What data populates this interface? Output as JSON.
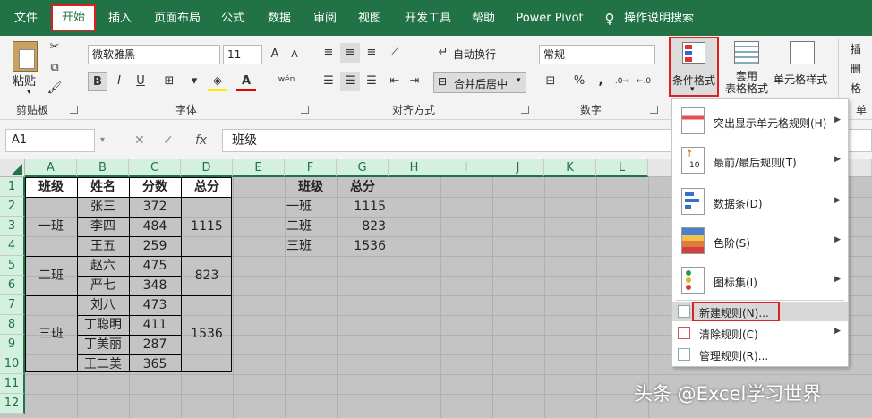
{
  "tabs": [
    "文件",
    "开始",
    "插入",
    "页面布局",
    "公式",
    "数据",
    "审阅",
    "视图",
    "开发工具",
    "帮助",
    "Power Pivot",
    "操作说明搜索"
  ],
  "ribbon": {
    "paste": "粘贴",
    "font_name": "微软雅黑",
    "font_size": "11",
    "wrap": "自动换行",
    "merge": "合并后居中",
    "number_format": "常规",
    "cond_format": "条件格式",
    "table_format": "套用\n表格格式",
    "cell_style": "单元格样式",
    "insert_short": "插",
    "delete_short": "删",
    "format_short": "格",
    "phonetic": "wén",
    "groups": [
      "剪贴板",
      "字体",
      "对齐方式",
      "数字",
      "单"
    ]
  },
  "formula_bar": {
    "name_box": "A1",
    "fx": "fx",
    "formula": "班级"
  },
  "columns": [
    "A",
    "B",
    "C",
    "D",
    "E",
    "F",
    "G",
    "H",
    "I",
    "J",
    "K",
    "L"
  ],
  "rows": [
    "1",
    "2",
    "3",
    "4",
    "5",
    "6",
    "7",
    "8",
    "9",
    "10",
    "11",
    "12"
  ],
  "table1": {
    "headers": [
      "班级",
      "姓名",
      "分数",
      "总分"
    ],
    "classes": [
      "一班",
      "二班",
      "三班"
    ],
    "names": [
      "张三",
      "李四",
      "王五",
      "赵六",
      "严七",
      "刘八",
      "丁聪明",
      "丁美丽",
      "王二美"
    ],
    "scores": [
      "372",
      "484",
      "259",
      "475",
      "348",
      "473",
      "411",
      "287",
      "365"
    ],
    "totals": [
      "1115",
      "823",
      "1536"
    ]
  },
  "table2": {
    "headers": [
      "班级",
      "总分"
    ],
    "rows": [
      [
        "一班",
        "1115"
      ],
      [
        "二班",
        "823"
      ],
      [
        "三班",
        "1536"
      ]
    ]
  },
  "menu": {
    "items": [
      "突出显示单元格规则(H)",
      "最前/最后规则(T)",
      "数据条(D)",
      "色阶(S)",
      "图标集(I)"
    ],
    "new_rule": "新建规则(N)...",
    "clear_rule": "清除规则(C)",
    "manage_rule": "管理规则(R)..."
  },
  "watermark": "头条 @Excel学习世界",
  "colors": {
    "excel_green": "#217346",
    "highlight_red": "#e02020",
    "selection_gray": "#c4c4c4"
  }
}
